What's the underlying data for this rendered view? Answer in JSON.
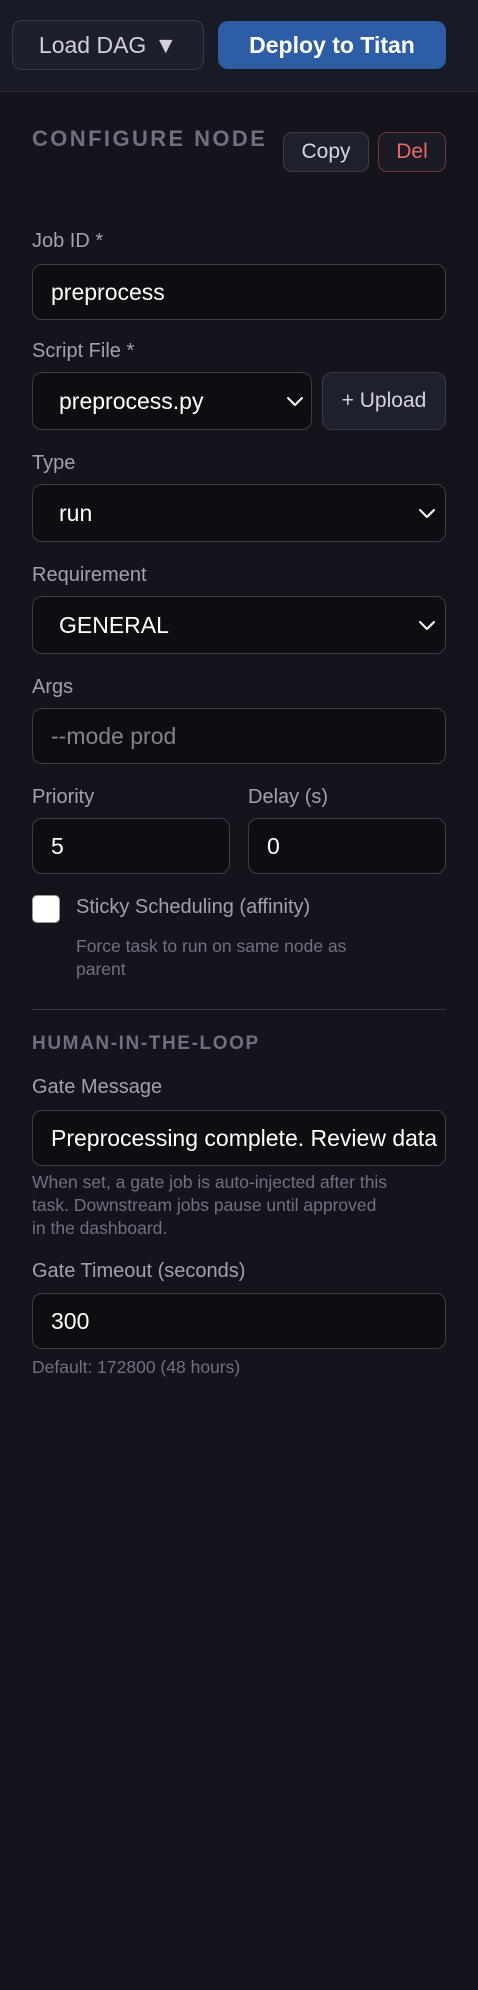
{
  "toolbar": {
    "load_dag_label": "Load DAG",
    "load_dag_caret": "▼",
    "deploy_label": "Deploy to Titan"
  },
  "panel": {
    "title": "CONFIGURE NODE",
    "copy_label": "Copy",
    "delete_label": "Del"
  },
  "form": {
    "job_id_label": "Job ID *",
    "job_id_value": "preprocess",
    "script_file_label": "Script File *",
    "script_file_value": "preprocess.py",
    "upload_label": "+ Upload",
    "type_label": "Type",
    "type_value": "run",
    "requirement_label": "Requirement",
    "requirement_value": "GENERAL",
    "args_label": "Args",
    "args_placeholder": "--mode prod",
    "priority_label": "Priority",
    "priority_value": "5",
    "delay_label": "Delay (s)",
    "delay_value": "0",
    "sticky_label": "Sticky Scheduling (affinity)",
    "sticky_checked": false,
    "sticky_help_line1": "Force task to run on same node as",
    "sticky_help_line2": "parent"
  },
  "hitl": {
    "title": "HUMAN-IN-THE-LOOP",
    "gate_message_label": "Gate Message",
    "gate_message_value": "Preprocessing complete. Review data",
    "gate_help_line1": "When set, a gate job is auto-injected after this",
    "gate_help_line2": "task. Downstream jobs pause until approved",
    "gate_help_line3": "in the dashboard.",
    "gate_timeout_label": "Gate Timeout (seconds)",
    "gate_timeout_value": "300",
    "gate_timeout_help": "Default: 172800 (48 hours)"
  },
  "colors": {
    "background": "#14141d",
    "accent": "#2d5ea5",
    "danger": "#e86a6a"
  }
}
